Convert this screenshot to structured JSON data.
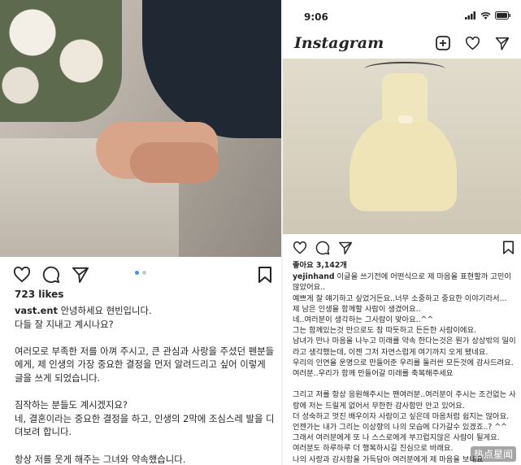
{
  "left_post": {
    "likes": "723 likes",
    "caption": {
      "username": "vast.ent",
      "first_line": " 안녕하세요 현빈입니다.",
      "body": "다들 잘 지내고 계시나요?\n\n여러모로 부족한 저를 아껴 주시고, 큰 관심과 사랑을 주셨던 펜분들에게, 제 인생의 가장 중요한 결정을 먼저 알려드리고 싶어 이렇게 글을 쓰게 되었습니다.\n\n짐작하는 분들도 계시겠지요?\n네, 결혼이라는 중요한 결정을 하고, 인생의 2막에 조심스레 발을 디뎌보려 합니다.\n\n항상 저를 웃게 해주는 그녀와 약속했습니다.\n앞으로의 날들을 함께 걸어가기로."
    }
  },
  "right_post": {
    "status_time": "9:06",
    "app_logo": "Instagram",
    "likes": "좋아요 3,142개",
    "caption": {
      "username": "yejinhand",
      "first_line": " 이글을 쓰기전에 어떤식으로 제 마음을 표현할까 고민이 많았어요..",
      "body": "예쁘게 잘 얘기하고 싶었거든요..너무 소중하고 중요한 이야기라서...\n제 남은 인생을 함께할 사람이 생겼어요..\n네..여러분이 생각하는 그사람이 맞아요..^^\n그는 함께있는것 만으로도 참 따듯하고 든든한 사람이에요.\n남녀가 만나 마음을 나누고 미래를 약속 한다는것은 뭔가 상상밖의 일이라고 생각했는데, 이젠 그저 자연스럽게 여기까지 오게 됐네요.\n우리의 인연을 운명으로 만들어준 우리를 둘러싼 모든것에 감사드려요.\n여러분..우리가 함께 만들어갈 미래를 축복해주세요\n\n그리고 저를 항상 응원해주시는 팬여러분..여러분이 주시는 조건없는 사랑에 저는 드릴게 없어서 무한한 감사함만 안고 있어요.\n더 성숙하고 멋진 배우이자 사람이고 싶은데 마음처럼 쉽지는 않아요.\n언젠가는 내가 그리는 이상향의 나의 모습에 다가갈수 있겠죠..? ^^\n그래서 여러분에게 또 나 스스로에게 부끄럽지않은 사람이 될게요.\n여러분도 하루하루 더 행복하시길 진심으로 바래요.\n나의 사랑과 감사함을 가득담아 여러분에게 제 마음을 보내요"
    }
  },
  "watermark": "热点星闻",
  "colors": {
    "text": "#262626",
    "carousel_active": "#3897f0",
    "carousel_inactive": "#c7c7c7"
  },
  "icons": [
    "heart-icon",
    "comment-icon",
    "share-icon",
    "bookmark-icon",
    "plus-square-icon",
    "signal-icon",
    "wifi-icon",
    "battery-icon"
  ]
}
